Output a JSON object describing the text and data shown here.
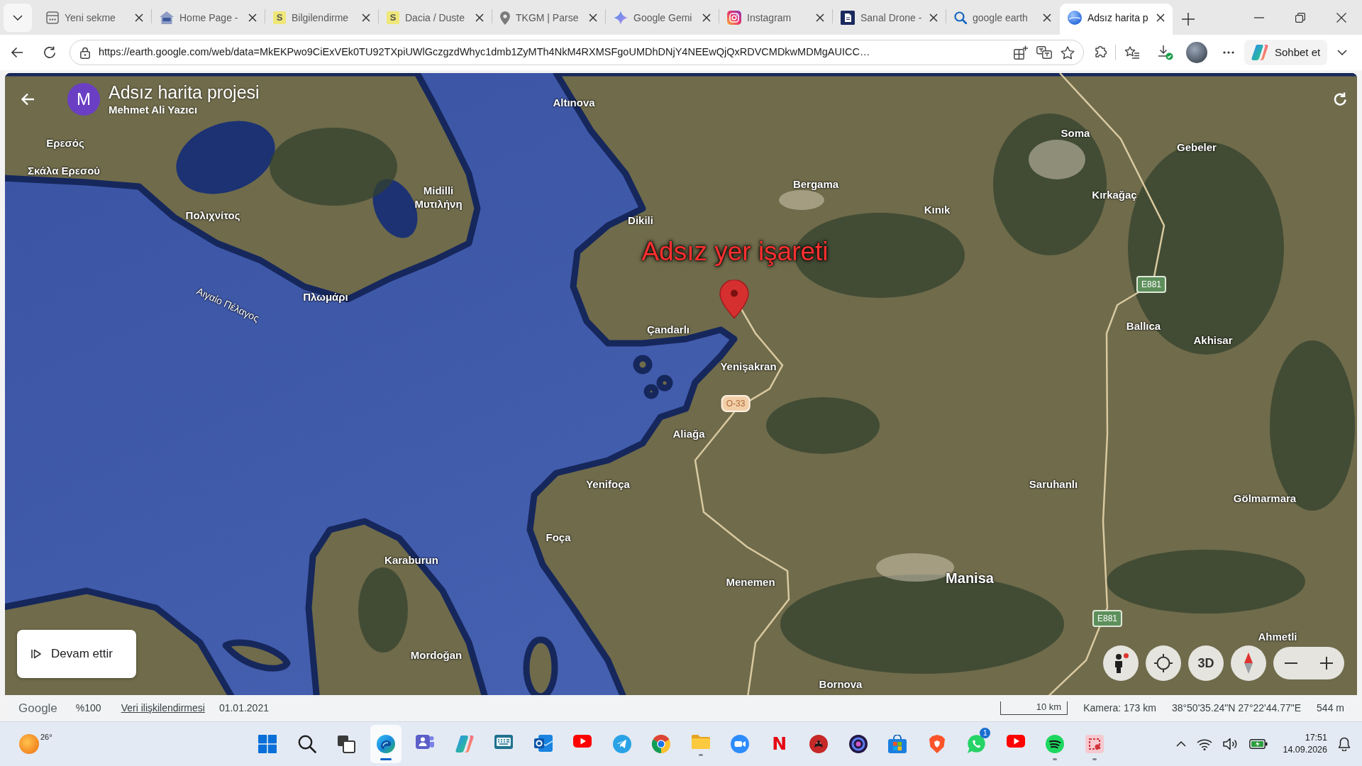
{
  "browser": {
    "tabs": [
      {
        "title": "Yeni sekme",
        "selected": false
      },
      {
        "title": "Home Page -",
        "selected": false
      },
      {
        "title": "Bilgilendirme",
        "icon_letter": "S",
        "selected": false
      },
      {
        "title": "Dacia / Duste",
        "icon_letter": "S",
        "selected": false
      },
      {
        "title": "TKGM | Parse",
        "selected": false
      },
      {
        "title": "Google Gemi",
        "selected": false
      },
      {
        "title": "Instagram",
        "selected": false
      },
      {
        "title": "Sanal Drone -",
        "selected": false
      },
      {
        "title": "google earth",
        "selected": false
      },
      {
        "title": "Adsız harita p",
        "selected": true
      }
    ],
    "url": "https://earth.google.com/web/data=MkEKPwo9CiExVEk0TU92TXpiUWlGczgzdWhyc1dmb1ZyMTh4NkM4RXMSFgoUMDhDNjY4NEEwQjQxRDVCMDkwMDMgAUICC…",
    "chat_button": "Sohbet et"
  },
  "project": {
    "avatar_letter": "M",
    "title": "Adsız harita projesi",
    "owner": "Mehmet Ali Yazıcı"
  },
  "map": {
    "labels": [
      {
        "text": "Altınova",
        "kind": "place"
      },
      {
        "text": "Soma",
        "kind": "place"
      },
      {
        "text": "Ερεσός",
        "kind": "place"
      },
      {
        "text": "Gebeler",
        "kind": "place"
      },
      {
        "text": "Σκάλα Ερεσού",
        "kind": "place"
      },
      {
        "text": "Bergama",
        "kind": "place"
      },
      {
        "text": "Midilli",
        "kind": "place"
      },
      {
        "text": "Kırkağaç",
        "kind": "place"
      },
      {
        "text": "Μυτιλήνη",
        "kind": "place"
      },
      {
        "text": "Kınık",
        "kind": "place"
      },
      {
        "text": "Πολιχνίτος",
        "kind": "place"
      },
      {
        "text": "Dikili",
        "kind": "place"
      },
      {
        "text": "Πλωμάρι",
        "kind": "place"
      },
      {
        "text": "Αιγαίο Πέλαγος",
        "kind": "sea"
      },
      {
        "text": "Ballıca",
        "kind": "place"
      },
      {
        "text": "Çandarlı",
        "kind": "place"
      },
      {
        "text": "Akhisar",
        "kind": "place"
      },
      {
        "text": "Yenişakran",
        "kind": "place"
      },
      {
        "text": "Aliağa",
        "kind": "place"
      },
      {
        "text": "Yenifoça",
        "kind": "place"
      },
      {
        "text": "Saruhanlı",
        "kind": "place"
      },
      {
        "text": "Gölmarmara",
        "kind": "place"
      },
      {
        "text": "Foça",
        "kind": "place"
      },
      {
        "text": "Karaburun",
        "kind": "place"
      },
      {
        "text": "Manisa",
        "kind": "city"
      },
      {
        "text": "Menemen",
        "kind": "place"
      },
      {
        "text": "Ahmetli",
        "kind": "place"
      },
      {
        "text": "Mordoğan",
        "kind": "place"
      },
      {
        "text": "Bornova",
        "kind": "place"
      }
    ],
    "road_signs": [
      {
        "text": "E881",
        "kind": "e-road"
      },
      {
        "text": "O-33",
        "kind": "motorway"
      },
      {
        "text": "E881",
        "kind": "e-road"
      }
    ],
    "placemark": {
      "label": "Adsız yer işareti"
    }
  },
  "resume_button": "Devam ettir",
  "map_controls": {
    "view_mode": "3D"
  },
  "status_bar": {
    "logo": "Google",
    "zoom": "%100",
    "attribution_link": "Veri ilişkilendirmesi",
    "imagery_date": "01.01.2021",
    "scale": "10 km",
    "camera": "Kamera: 173 km",
    "coordinates": "38°50'35.24\"N 27°22'44.77\"E",
    "elevation": "544 m"
  },
  "taskbar": {
    "weather": "26°",
    "apps": [
      {
        "running": false,
        "selected": false
      },
      {
        "running": false,
        "selected": false
      },
      {
        "running": false,
        "selected": false
      },
      {
        "running": true,
        "selected": true
      },
      {
        "running": false,
        "selected": false
      },
      {
        "running": false,
        "selected": false
      },
      {
        "running": false,
        "selected": false
      },
      {
        "running": false,
        "selected": false
      },
      {
        "running": false,
        "selected": false
      },
      {
        "running": false,
        "selected": false
      },
      {
        "running": false,
        "selected": false
      },
      {
        "running": true,
        "selected": false
      },
      {
        "running": false,
        "selected": false
      },
      {
        "icon_letter": "N",
        "running": false,
        "selected": false
      },
      {
        "running": false,
        "selected": false
      },
      {
        "running": false,
        "selected": false
      },
      {
        "running": false,
        "selected": false
      },
      {
        "running": false,
        "selected": false
      },
      {
        "badge": "1",
        "running": false,
        "selected": false
      },
      {
        "running": false,
        "selected": false
      },
      {
        "running": true,
        "selected": false
      },
      {
        "running": true,
        "selected": false
      }
    ],
    "clock": {
      "time": "17:51",
      "date": "14.09.2026"
    }
  }
}
